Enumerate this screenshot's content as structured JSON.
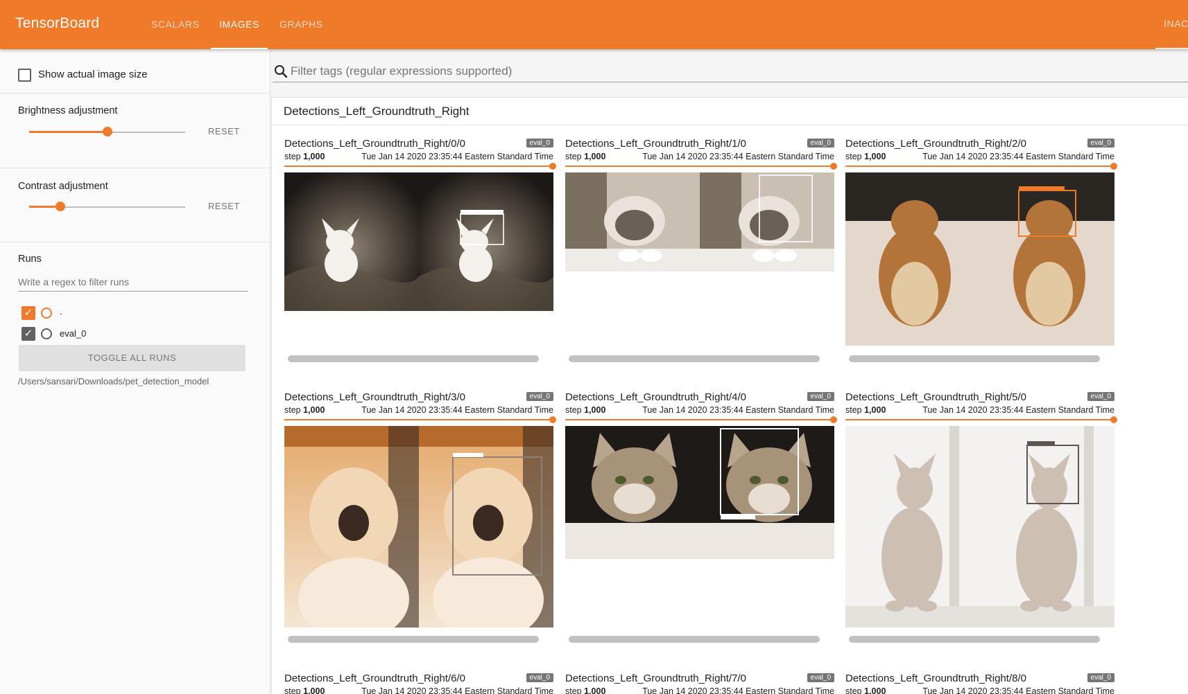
{
  "header": {
    "brand": "TensorBoard",
    "tabs": [
      {
        "label": "SCALARS",
        "active": false
      },
      {
        "label": "IMAGES",
        "active": true
      },
      {
        "label": "GRAPHS",
        "active": false
      }
    ],
    "right_label": "INACTIVE"
  },
  "sidebar": {
    "show_actual_size_label": "Show actual image size",
    "show_actual_size_checked": false,
    "brightness": {
      "label": "Brightness adjustment",
      "reset": "RESET",
      "level": 0.5
    },
    "contrast": {
      "label": "Contrast adjustment",
      "reset": "RESET",
      "level": 0.2
    },
    "runs": {
      "title": "Runs",
      "filter_placeholder": "Write a regex to filter runs",
      "items": [
        {
          "label": ".",
          "checked": true,
          "color": "#ef7a2a"
        },
        {
          "label": "eval_0",
          "checked": true,
          "color": "#616161"
        }
      ],
      "toggle_all": "TOGGLE ALL RUNS",
      "logdir": "/Users/sansari/Downloads/pet_detection_model"
    }
  },
  "main": {
    "filter_placeholder": "Filter tags (regular expressions supported)",
    "pane_title": "Detections_Left_Groundtruth_Right",
    "cards": [
      {
        "title": "Detections_Left_Groundtruth_Right/0/0",
        "run": "eval_0",
        "step_label": "step",
        "step": "1,000",
        "time": "Tue Jan 14 2020 23:35:44 Eastern Standard Time"
      },
      {
        "title": "Detections_Left_Groundtruth_Right/1/0",
        "run": "eval_0",
        "step_label": "step",
        "step": "1,000",
        "time": "Tue Jan 14 2020 23:35:44 Eastern Standard Time"
      },
      {
        "title": "Detections_Left_Groundtruth_Right/2/0",
        "run": "eval_0",
        "step_label": "step",
        "step": "1,000",
        "time": "Tue Jan 14 2020 23:35:44 Eastern Standard Time"
      },
      {
        "title": "Detections_Left_Groundtruth_Right/3/0",
        "run": "eval_0",
        "step_label": "step",
        "step": "1,000",
        "time": "Tue Jan 14 2020 23:35:44 Eastern Standard Time"
      },
      {
        "title": "Detections_Left_Groundtruth_Right/4/0",
        "run": "eval_0",
        "step_label": "step",
        "step": "1,000",
        "time": "Tue Jan 14 2020 23:35:44 Eastern Standard Time"
      },
      {
        "title": "Detections_Left_Groundtruth_Right/5/0",
        "run": "eval_0",
        "step_label": "step",
        "step": "1,000",
        "time": "Tue Jan 14 2020 23:35:44 Eastern Standard Time"
      },
      {
        "title": "Detections_Left_Groundtruth_Right/6/0",
        "run": "eval_0",
        "step_label": "step",
        "step": "1,000",
        "time": "Tue Jan 14 2020 23:35:44 Eastern Standard Time"
      },
      {
        "title": "Detections_Left_Groundtruth_Right/7/0",
        "run": "eval_0",
        "step_label": "step",
        "step": "1,000",
        "time": "Tue Jan 14 2020 23:35:44 Eastern Standard Time"
      },
      {
        "title": "Detections_Left_Groundtruth_Right/8/0",
        "run": "eval_0",
        "step_label": "step",
        "step": "1,000",
        "time": "Tue Jan 14 2020 23:35:44 Eastern Standard Time"
      }
    ],
    "images": [
      {
        "subject": "chihuahua",
        "box_label": "chihuahua: 18%"
      },
      {
        "subject": "ragdoll cat",
        "box_label": ""
      },
      {
        "subject": "yorkshire terrier",
        "box_label": ""
      },
      {
        "subject": "ragdoll cat",
        "box_label": "Ragdoll: 93%"
      },
      {
        "subject": "tabby cat",
        "box_label": "Bengal: 93%"
      },
      {
        "subject": "sphynx cat",
        "box_label": "Sphynx: 93%"
      }
    ]
  },
  "colors": {
    "accent": "#ef7a2a",
    "badge": "#757575"
  }
}
